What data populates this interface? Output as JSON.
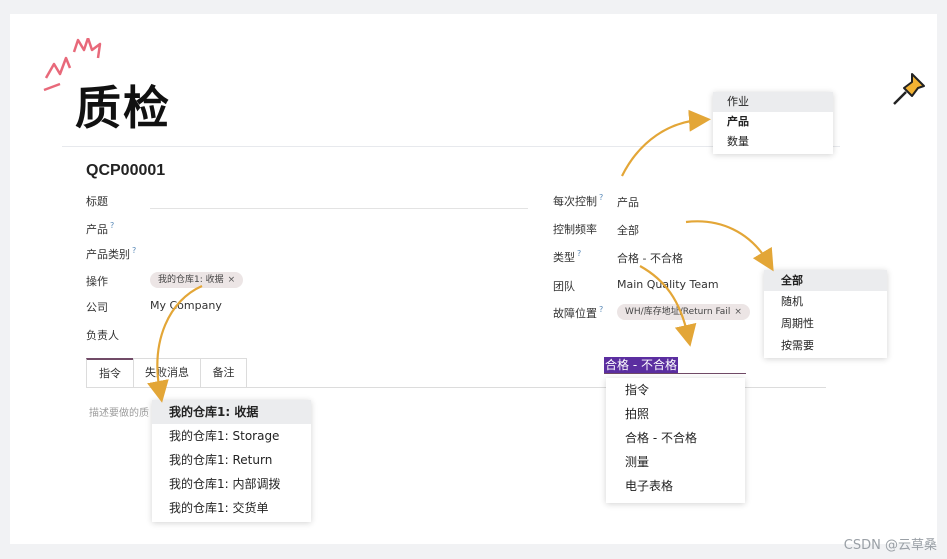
{
  "slide": {
    "title": "质检",
    "watermark": "CSDN @云草桑"
  },
  "form": {
    "record_id": "QCP00001",
    "left_fields": [
      {
        "label": "标题",
        "help": "",
        "value": ""
      },
      {
        "label": "产品",
        "help": "?",
        "value": ""
      },
      {
        "label": "产品类别",
        "help": "?",
        "value": ""
      },
      {
        "label": "操作",
        "help": "",
        "value": ""
      },
      {
        "label": "公司",
        "help": "",
        "value": "My Company"
      },
      {
        "label": "负责人",
        "help": "",
        "value": ""
      }
    ],
    "operation_tag": "我的仓库1: 收据",
    "right_fields": [
      {
        "label": "每次控制",
        "help": "?",
        "value": "产品"
      },
      {
        "label": "控制频率",
        "help": "",
        "value": "全部"
      },
      {
        "label": "类型",
        "help": "?",
        "value": "合格 - 不合格"
      },
      {
        "label": "团队",
        "help": "",
        "value": "Main Quality Team"
      },
      {
        "label": "故障位置",
        "help": "?",
        "value": ""
      }
    ],
    "failure_tag": "WH/库存地址/Return Fail",
    "tabs": [
      "指令",
      "失败消息",
      "备注"
    ],
    "instructions_placeholder": "描述要做的质"
  },
  "dropdowns": {
    "control_per": [
      "作业",
      "产品",
      "数量"
    ],
    "frequency": [
      "全部",
      "随机",
      "周期性",
      "按需要"
    ],
    "type_input": "合格 - 不合格",
    "type": [
      "指令",
      "拍照",
      "合格 - 不合格",
      "测量",
      "电子表格"
    ],
    "operations": [
      "我的仓库1: 收据",
      "我的仓库1: Storage",
      "我的仓库1: Return",
      "我的仓库1: 内部调拨",
      "我的仓库1: 交货单"
    ]
  },
  "icons": {
    "close": "×",
    "decor": "spark-icon",
    "pin": "pushpin-icon"
  },
  "colors": {
    "accent": "#714b67",
    "arrow": "#e3a637",
    "highlight": "#5b2ea0"
  }
}
